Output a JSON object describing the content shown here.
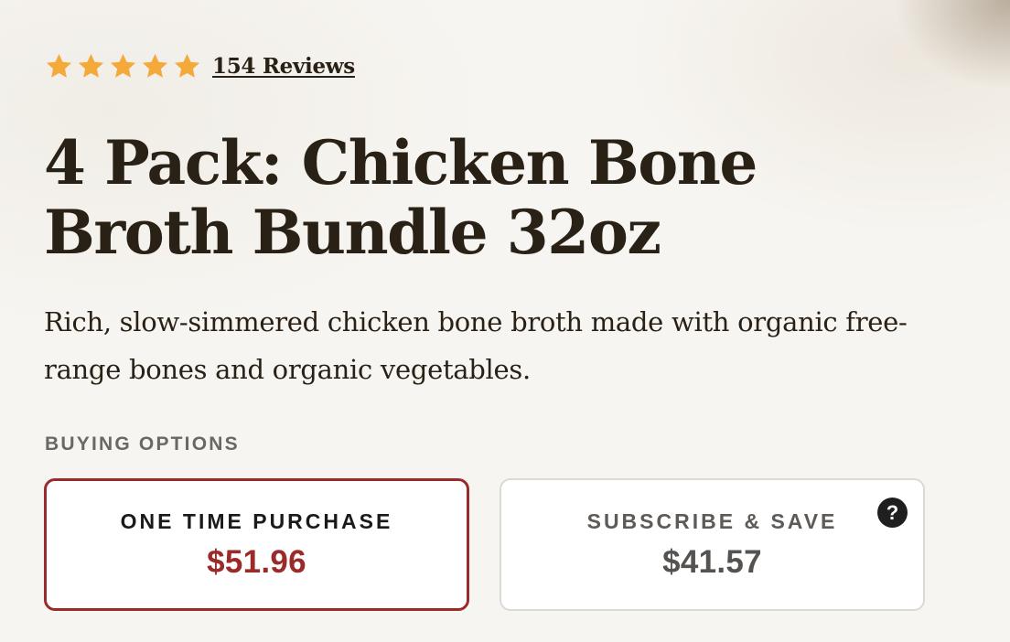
{
  "rating": {
    "value": 5,
    "max": 5,
    "star_color": "#f4a93b",
    "reviews_label": "154 Reviews"
  },
  "product": {
    "title": "4 Pack: Chicken Bone Broth Bundle 32oz",
    "description": "Rich, slow-simmered chicken bone broth made with organic free-range bones and organic vegetables."
  },
  "buying_options": {
    "label": "BUYING OPTIONS",
    "options": [
      {
        "name": "ONE TIME PURCHASE",
        "price": "$51.96",
        "selected": true
      },
      {
        "name": "SUBSCRIBE & SAVE",
        "price": "$41.57",
        "selected": false,
        "help_icon": "question-mark-icon",
        "help_glyph": "?"
      }
    ]
  },
  "colors": {
    "accent": "#9b2a2a",
    "text": "#2a2116",
    "background": "#f7f5f1"
  }
}
